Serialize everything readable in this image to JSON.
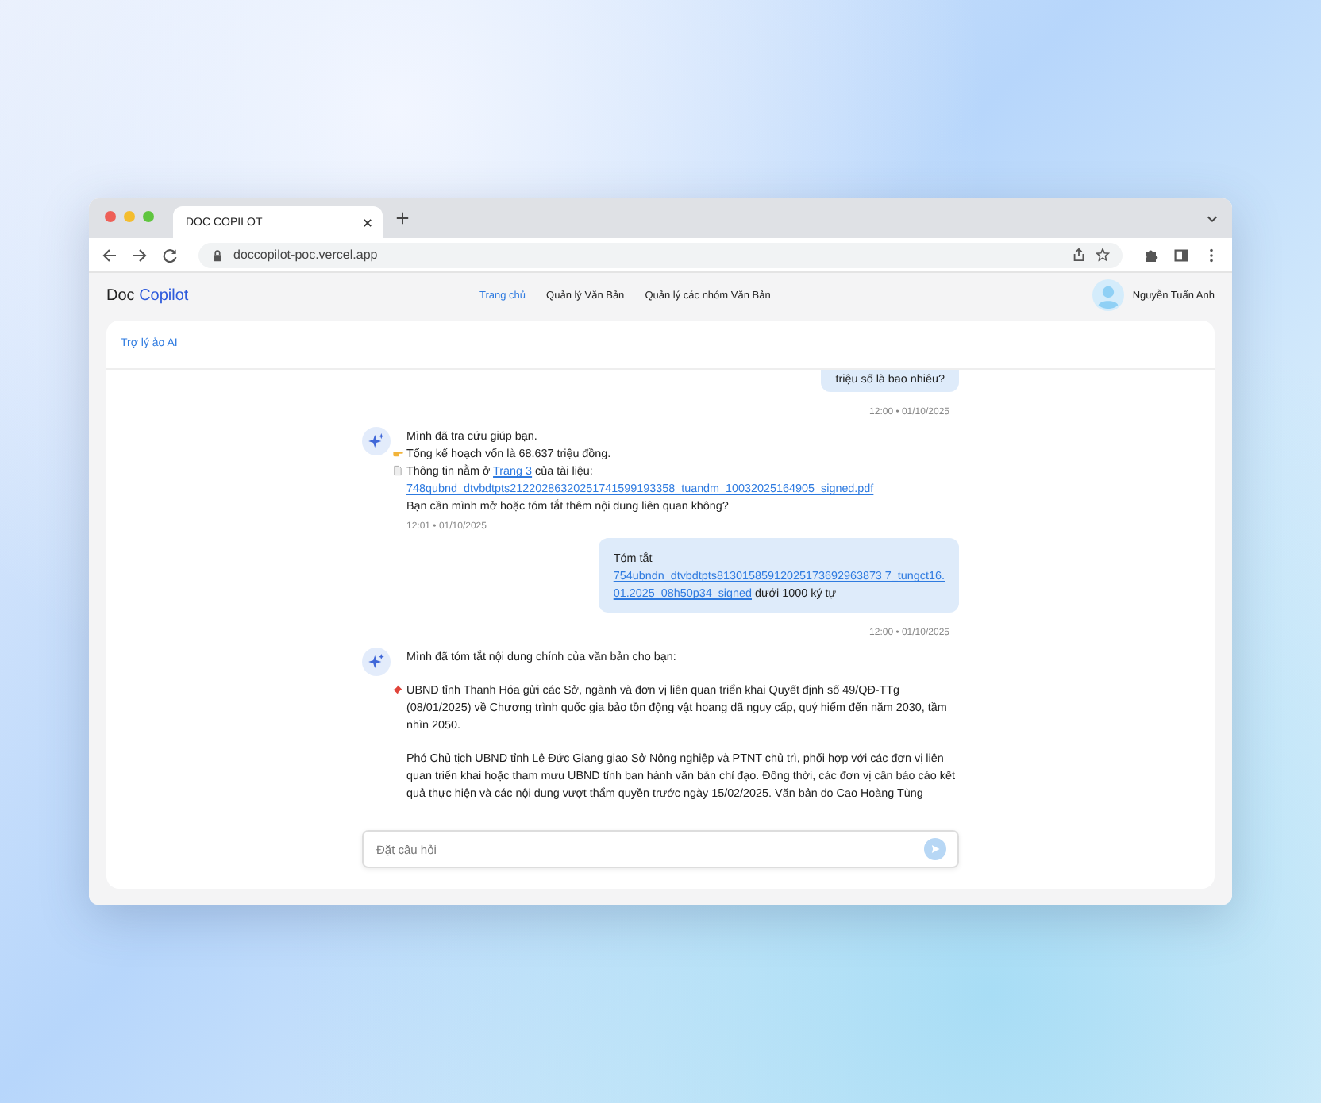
{
  "browser": {
    "tab_title": "DOC COPILOT",
    "url": "doccopilot-poc.vercel.app"
  },
  "app": {
    "logo": {
      "first": "Doc",
      "second": "Copilot"
    },
    "nav": [
      {
        "label": "Trang chủ",
        "selected": true
      },
      {
        "label": "Quản lý Văn Bản",
        "selected": false
      },
      {
        "label": "Quản lý các nhóm Văn Bản",
        "selected": false
      }
    ],
    "user_name": "Nguyễn Tuấn Anh"
  },
  "panel": {
    "title": "Trợ lý ảo AI"
  },
  "messages": [
    {
      "kind": "user",
      "time": "12:00 • 01/10/2025",
      "paragraphs": [
        {
          "lines": [
            [
              {
                "kind": "text",
                "text": "triệu số là bao nhiêu?"
              }
            ]
          ]
        }
      ]
    },
    {
      "kind": "bot",
      "time": "12:01 • 01/10/2025",
      "paragraphs": [
        {
          "kind": "plain",
          "lines": [
            [
              {
                "kind": "text",
                "text": "Mình đã tra cứu giúp bạn."
              }
            ]
          ]
        },
        {
          "kind": "result",
          "lines": [
            [
              {
                "kind": "text",
                "text": "Tổng kế hoạch vốn là 68.637 triệu đồng."
              }
            ]
          ]
        },
        {
          "kind": "source",
          "lines": [
            [
              {
                "kind": "text",
                "text": "Thông tin nằm ở "
              },
              {
                "kind": "link",
                "text": "Trang 3"
              },
              {
                "kind": "text",
                "text": " của tài liệu:"
              }
            ]
          ]
        },
        {
          "kind": "plain",
          "lines": [
            [
              {
                "kind": "link",
                "text": "748qubnd_dtvbdtpts21220286320251741599193358_tuandm_10032025164905_signed.pdf"
              }
            ]
          ]
        },
        {
          "kind": "plain",
          "lines": [
            [
              {
                "kind": "text",
                "text": "Bạn cần mình mở hoặc tóm tắt thêm nội dung liên quan không?"
              }
            ]
          ]
        }
      ]
    },
    {
      "kind": "user",
      "time": "12:00 • 01/10/2025",
      "paragraphs": [
        {
          "lines": [
            [
              {
                "kind": "text",
                "text": "Tóm tắt"
              }
            ]
          ]
        },
        {
          "lines": [
            [
              {
                "kind": "link",
                "text": "754ubndn_dtvbdtpts81301585912025173692963873 7_tungct16."
              }
            ]
          ]
        },
        {
          "lines": [
            [
              {
                "kind": "link",
                "text": "01.2025_08h50p34_signed"
              },
              {
                "kind": "text",
                "text": " dưới 1000 ký tự"
              }
            ]
          ]
        }
      ]
    },
    {
      "kind": "bot",
      "paragraphs": [
        {
          "kind": "plain",
          "lines": [
            [
              {
                "kind": "text",
                "text": "Mình đã tóm tắt nội dung chính của văn bản cho bạn:"
              }
            ]
          ]
        },
        {
          "kind": "highlight",
          "spaced": true,
          "lines": [
            [
              {
                "kind": "text",
                "text": "UBND tỉnh Thanh Hóa gửi các Sở, ngành và đơn vị liên quan triển khai Quyết định số 49/QĐ-TTg (08/01/2025) về Chương trình quốc gia bảo tồn động vật hoang dã nguy cấp, quý hiếm đến năm 2030, tầm nhìn 2050."
              }
            ]
          ]
        },
        {
          "kind": "plain",
          "spaced": true,
          "lines": [
            [
              {
                "kind": "text",
                "text": "Phó Chủ tịch UBND tỉnh Lê Đức Giang giao Sở Nông nghiệp và PTNT chủ trì, phối hợp với các đơn vị liên quan triển khai hoặc tham mưu UBND tỉnh ban hành văn bản chỉ đạo. Đồng thời, các đơn vị cần báo cáo kết quả thực hiện và các nội dung vượt thẩm quyền trước ngày 15/02/2025. Văn bản do Cao Hoàng Tùng"
              }
            ]
          ]
        }
      ]
    }
  ],
  "input": {
    "placeholder": "Đặt câu hỏi"
  }
}
